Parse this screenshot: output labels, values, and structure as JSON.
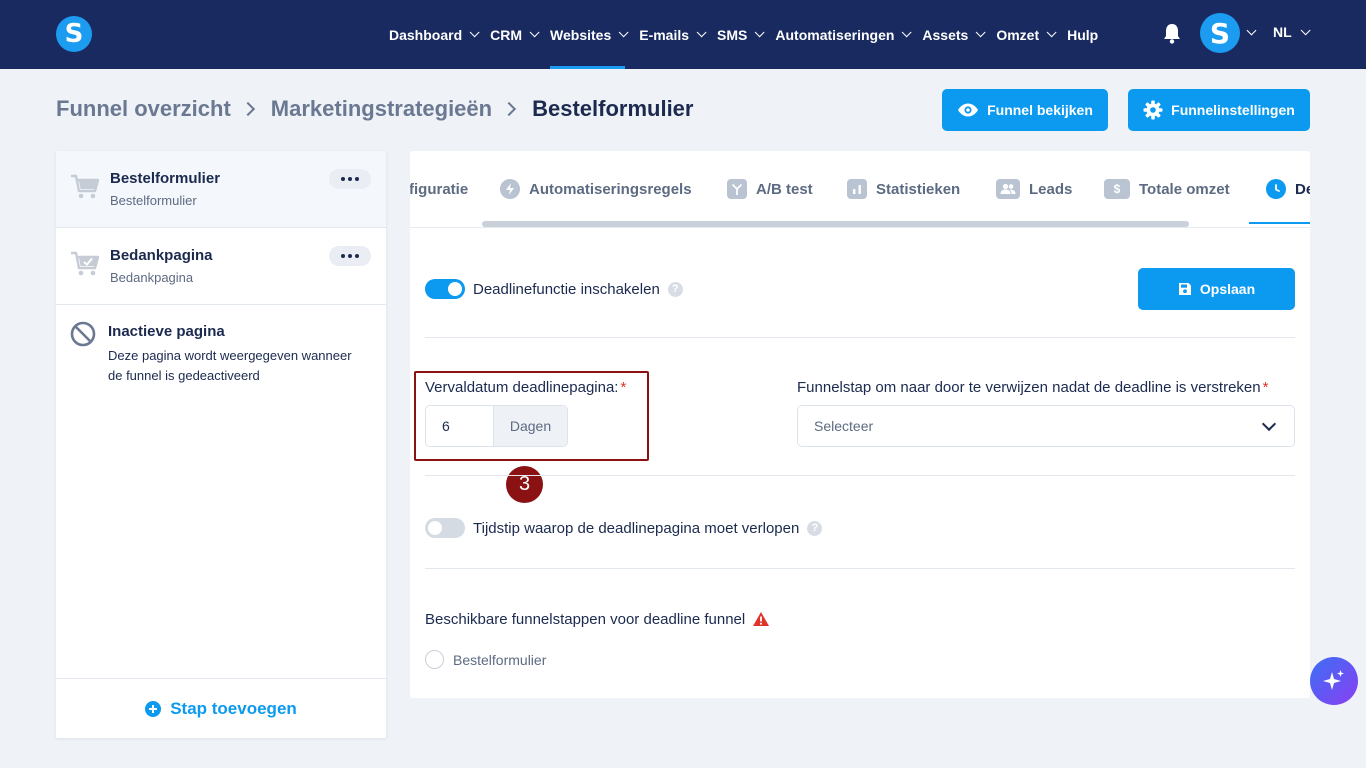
{
  "nav": {
    "logo": "S",
    "items": [
      {
        "label": "Dashboard"
      },
      {
        "label": "CRM"
      },
      {
        "label": "Websites"
      },
      {
        "label": "E-mails"
      },
      {
        "label": "SMS"
      },
      {
        "label": "Automatiseringen"
      },
      {
        "label": "Assets"
      },
      {
        "label": "Omzet"
      },
      {
        "label": "Hulp"
      }
    ],
    "active_item": "Websites",
    "avatar": "S",
    "language": "NL"
  },
  "breadcrumb": {
    "items": [
      "Funnel overzicht",
      "Marketingstrategieën"
    ],
    "current": "Bestelformulier"
  },
  "header_buttons": {
    "view_funnel": "Funnel bekijken",
    "funnel_settings": "Funnelinstellingen"
  },
  "sidebar": {
    "steps": [
      {
        "title": "Bestelformulier",
        "subtitle": "Bestelformulier"
      },
      {
        "title": "Bedankpagina",
        "subtitle": "Bedankpagina"
      }
    ],
    "inactive": {
      "title": "Inactieve pagina",
      "description": "Deze pagina wordt weergegeven wanneer de funnel is gedeactiveerd"
    },
    "add_step": "Stap toevoegen"
  },
  "tabs": {
    "items": [
      {
        "label": "figuratie"
      },
      {
        "label": "Automatiseringsregels",
        "icon": "lightning-icon"
      },
      {
        "label": "A/B test",
        "icon": "split-icon"
      },
      {
        "label": "Statistieken",
        "icon": "bar-chart-icon"
      },
      {
        "label": "Leads",
        "icon": "users-icon"
      },
      {
        "label": "Totale omzet",
        "icon": "dollar-icon"
      },
      {
        "label": "De",
        "icon": "clock-icon"
      }
    ],
    "active_index": 6
  },
  "deadline": {
    "enable_label": "Deadlinefunctie inschakelen",
    "enable_on": true,
    "save_button": "Opslaan",
    "expiry_label": "Vervaldatum deadlinepagina:",
    "expiry_value": "6",
    "expiry_unit": "Dagen",
    "redirect_label": "Funnelstap om naar door te verwijzen nadat de deadline is verstreken",
    "redirect_placeholder": "Selecteer",
    "required_mark": "*",
    "annotation_number": "3",
    "time_label": "Tijdstip waarop de deadlinepagina moet verlopen",
    "time_on": false,
    "available_label": "Beschikbare funnelstappen voor deadline funnel",
    "available_options": [
      "Bestelformulier"
    ]
  },
  "help_mark": "?",
  "colors": {
    "nav_bg": "#192a61",
    "accent": "#0b9aef",
    "annotation": "#8b1212",
    "warning": "#e0342b"
  }
}
